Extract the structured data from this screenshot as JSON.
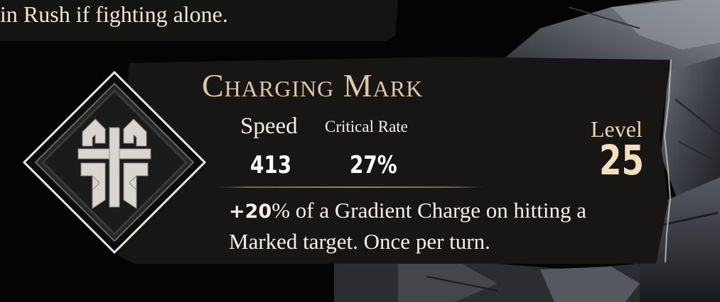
{
  "previous_tooltip": {
    "text": "in Rush if fighting alone."
  },
  "skill": {
    "title": "Charging Mark",
    "stats": {
      "speed_label": "Speed",
      "speed_value": "413",
      "crit_label": "Critical Rate",
      "crit_value": "27%"
    },
    "level_label": "Level",
    "level_value": "25",
    "description": {
      "bonus_sign": "+",
      "bonus_value": "20",
      "rest_line1": "% of a Gradient Charge on hitting a",
      "line2": "Marked target. Once per turn."
    },
    "icon": "charging-mark-emblem-icon"
  },
  "colors": {
    "title": "#dcc7a3",
    "level": "#f3dfbe",
    "card_bg": "#171614",
    "text": "#f4f1ea"
  }
}
